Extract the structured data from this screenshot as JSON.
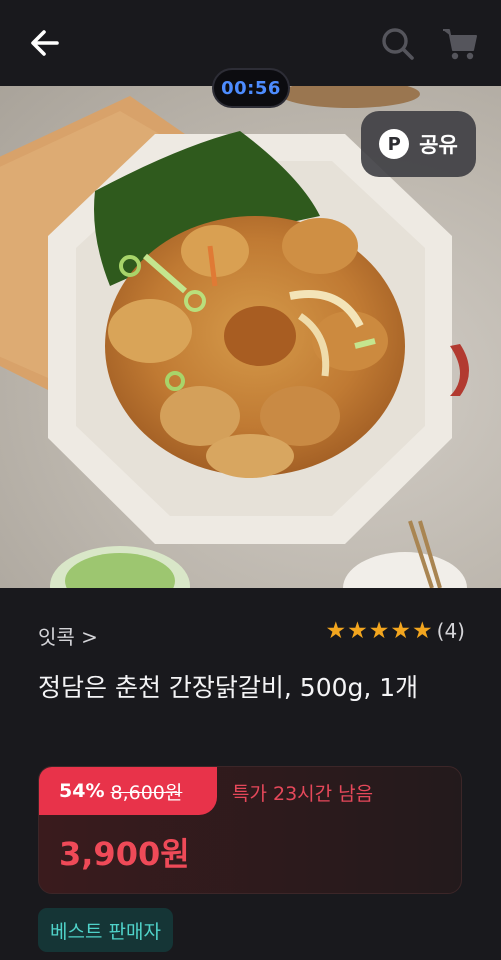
{
  "header": {
    "back_icon": "arrow-left-icon",
    "search_icon": "search-icon",
    "cart_icon": "cart-icon"
  },
  "hero": {
    "timer": "00:56",
    "share": {
      "icon_letter": "P",
      "label": "공유"
    }
  },
  "product": {
    "brand": "잇콕 >",
    "rating": {
      "stars": 5,
      "count": "(4)",
      "color": "#f3a61f"
    },
    "title": "정담은 춘천 간장닭갈비, 500g, 1개"
  },
  "price": {
    "discount": "54%",
    "original": "8,600원",
    "deal": "특가 23시간 남음",
    "sale": "3,900원",
    "accent": "#e8334a"
  },
  "badge": {
    "label": "베스트 판매자",
    "color": "#4fd2c9"
  }
}
